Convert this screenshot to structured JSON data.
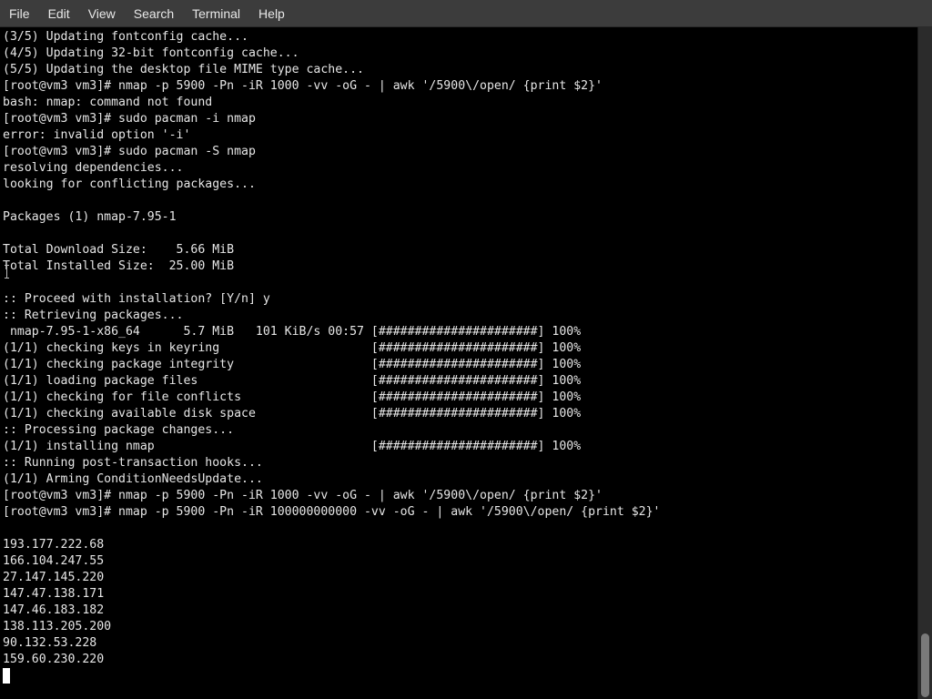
{
  "menubar": {
    "items": [
      "File",
      "Edit",
      "View",
      "Search",
      "Terminal",
      "Help"
    ]
  },
  "terminal": {
    "lines": [
      "(3/5) Updating fontconfig cache...",
      "(4/5) Updating 32-bit fontconfig cache...",
      "(5/5) Updating the desktop file MIME type cache...",
      "[root@vm3 vm3]# nmap -p 5900 -Pn -iR 1000 -vv -oG - | awk '/5900\\/open/ {print $2}'",
      "bash: nmap: command not found",
      "[root@vm3 vm3]# sudo pacman -i nmap",
      "error: invalid option '-i'",
      "[root@vm3 vm3]# sudo pacman -S nmap",
      "resolving dependencies...",
      "looking for conflicting packages...",
      "",
      "Packages (1) nmap-7.95-1",
      "",
      "Total Download Size:    5.66 MiB",
      "Total Installed Size:  25.00 MiB",
      "",
      ":: Proceed with installation? [Y/n] y",
      ":: Retrieving packages...",
      " nmap-7.95-1-x86_64      5.7 MiB   101 KiB/s 00:57 [######################] 100%",
      "(1/1) checking keys in keyring                     [######################] 100%",
      "(1/1) checking package integrity                   [######################] 100%",
      "(1/1) loading package files                        [######################] 100%",
      "(1/1) checking for file conflicts                  [######################] 100%",
      "(1/1) checking available disk space                [######################] 100%",
      ":: Processing package changes...",
      "(1/1) installing nmap                              [######################] 100%",
      ":: Running post-transaction hooks...",
      "(1/1) Arming ConditionNeedsUpdate...",
      "[root@vm3 vm3]# nmap -p 5900 -Pn -iR 1000 -vv -oG - | awk '/5900\\/open/ {print $2}'",
      "[root@vm3 vm3]# nmap -p 5900 -Pn -iR 100000000000 -vv -oG - | awk '/5900\\/open/ {print $2}'",
      "",
      "193.177.222.68",
      "166.104.247.55",
      "27.147.145.220",
      "147.47.138.171",
      "147.46.183.182",
      "138.113.205.200",
      "90.132.53.228",
      "159.60.230.220"
    ]
  }
}
